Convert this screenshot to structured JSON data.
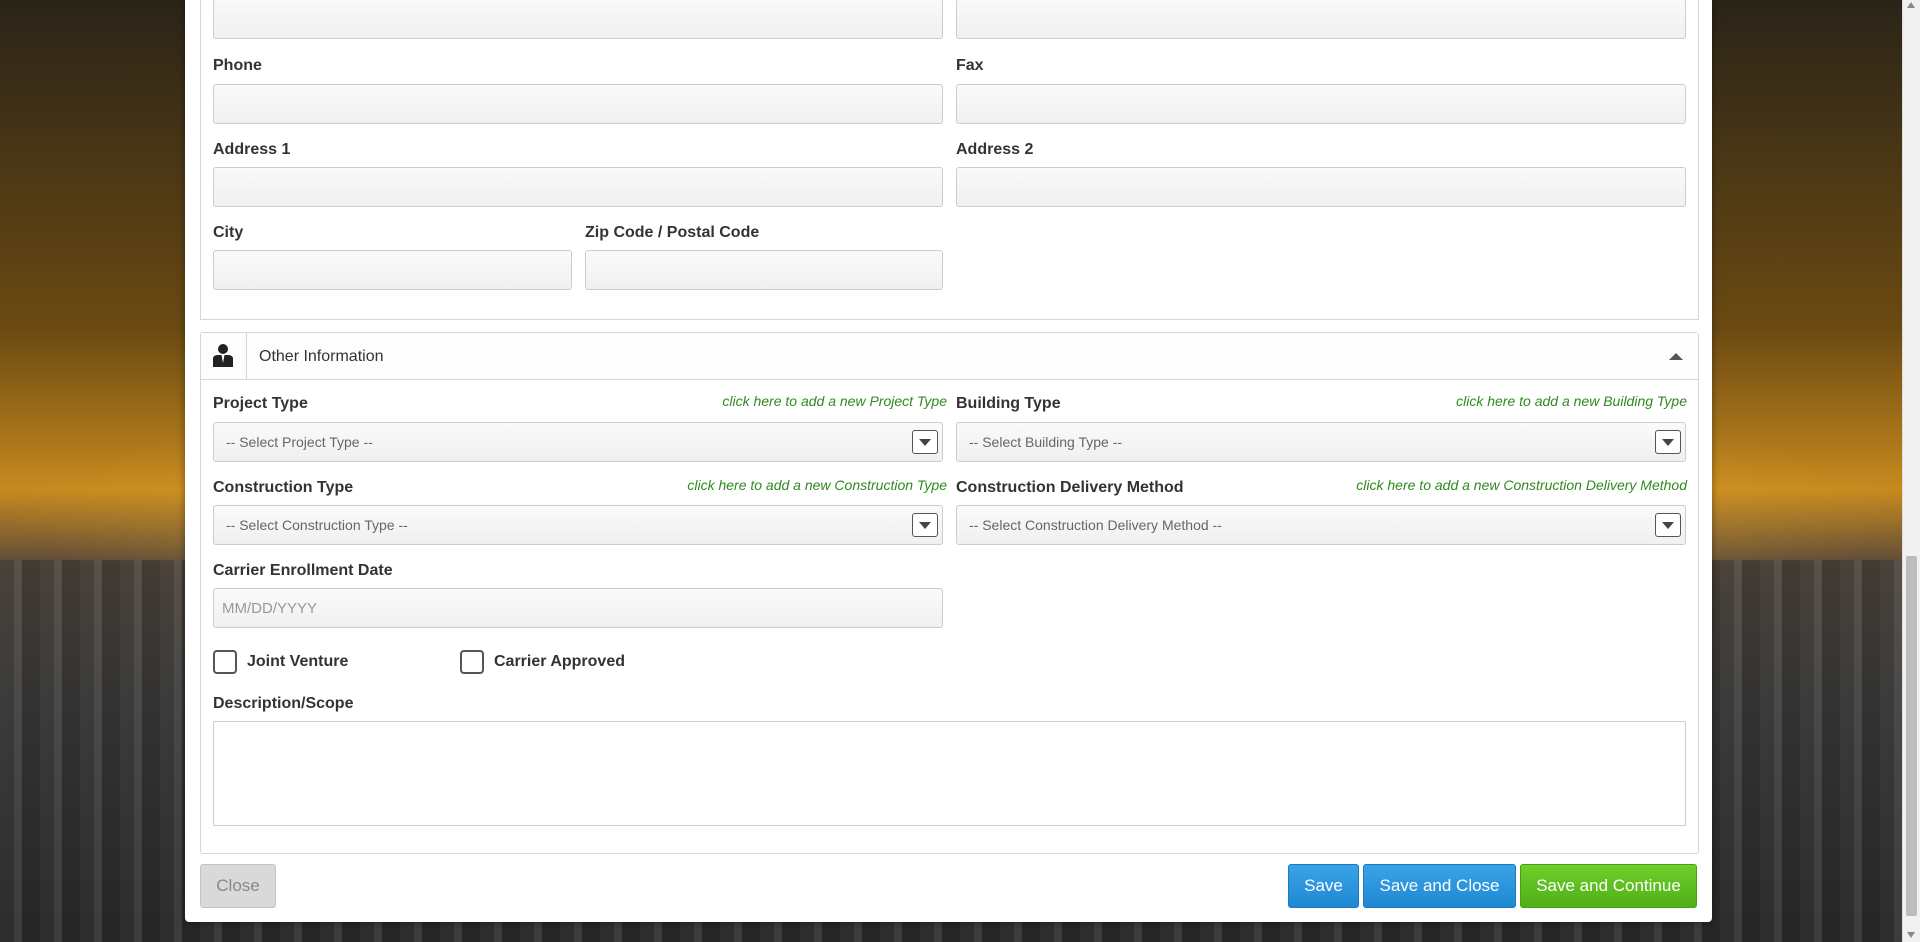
{
  "contact": {
    "phone_label": "Phone",
    "fax_label": "Fax",
    "address1_label": "Address 1",
    "address2_label": "Address 2",
    "city_label": "City",
    "zip_label": "Zip Code / Postal Code"
  },
  "other_info": {
    "title": "Other Information",
    "project_type_label": "Project Type",
    "project_type_link": "click here to add a new Project Type",
    "project_type_placeholder": "-- Select Project Type --",
    "building_type_label": "Building Type",
    "building_type_link": "click here to add a new Building Type",
    "building_type_placeholder": "-- Select Building Type --",
    "construction_type_label": "Construction Type",
    "construction_type_link": "click here to add a new Construction Type",
    "construction_type_placeholder": "-- Select Construction Type --",
    "delivery_method_label": "Construction Delivery Method",
    "delivery_method_link": "click here to add a new Construction Delivery Method",
    "delivery_method_placeholder": "-- Select Construction Delivery Method --",
    "enrollment_label": "Carrier Enrollment Date",
    "enrollment_placeholder": "MM/DD/YYYY",
    "joint_venture_label": "Joint Venture",
    "carrier_approved_label": "Carrier Approved",
    "description_label": "Description/Scope"
  },
  "footer": {
    "close_label": "Close",
    "save_label": "Save",
    "save_close_label": "Save and Close",
    "save_continue_label": "Save and Continue"
  },
  "icons": {
    "section_icon": "person-suit-icon",
    "collapse_icon": "chevron-up-icon",
    "dropdown_icon": "caret-down-icon"
  },
  "colors": {
    "link_green": "#2f8a1f",
    "button_blue": "#1e88d2",
    "button_green": "#4faf17"
  }
}
